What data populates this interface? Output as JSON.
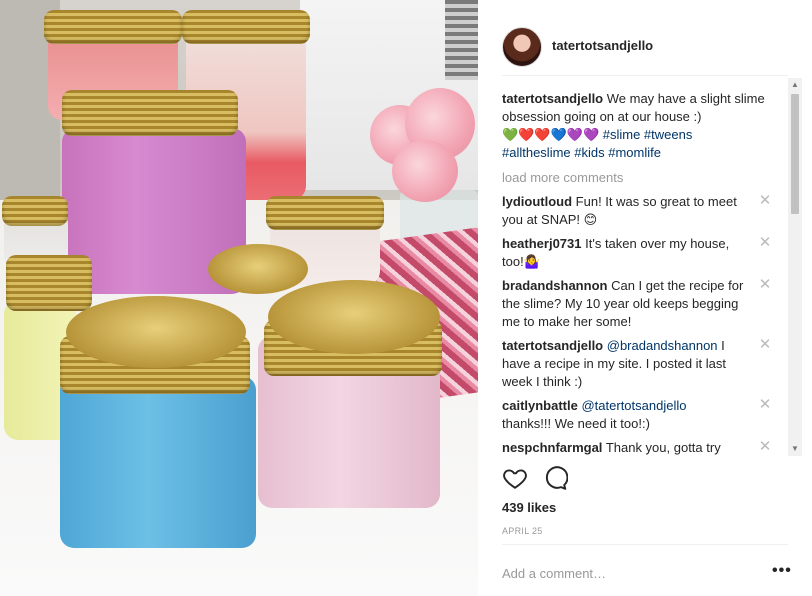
{
  "colors": {
    "link": "#003569",
    "muted": "#999999"
  },
  "header": {
    "username": "tatertotsandjello"
  },
  "caption": {
    "username": "tatertotsandjello",
    "text": "We may have a slight slime obsession going on at our house :)",
    "emoji": [
      "💚",
      "❤️",
      "❤️",
      "💙",
      "💜",
      "💜"
    ],
    "hashtags_line1": "#slime #tweens",
    "hashtags_line2": "#alltheslime #kids #momlife"
  },
  "load_more": "load more comments",
  "comments": [
    {
      "user": "lydioutloud",
      "text": "Fun! It was so great to meet you at SNAP! 😊"
    },
    {
      "user": "heatherj0731",
      "text": "It's taken over my house, too!🤷‍♀️"
    },
    {
      "user": "bradandshannon",
      "text": "Can I get the recipe for the slime? My 10 year old keeps begging me to make her some!"
    },
    {
      "user": "tatertotsandjello",
      "mention": "@bradandshannon",
      "text": "I have a recipe in my site. I posted it last week I think :)"
    },
    {
      "user": "caitlynbattle",
      "mention": "@tatertotsandjello",
      "text": "thanks!!! We need it too!:)"
    },
    {
      "user": "nespchnfarmgal",
      "text": "Thank you, gotta try"
    }
  ],
  "close_glyph": "✕",
  "actions": {
    "like_icon": "heart-icon",
    "comment_icon": "comment-icon"
  },
  "likes": "439 likes",
  "date": "APRIL 25",
  "add_comment": {
    "placeholder": "Add a comment…",
    "value": ""
  },
  "more_glyph": "•••",
  "scroll": {
    "up": "▲",
    "down": "▼"
  }
}
